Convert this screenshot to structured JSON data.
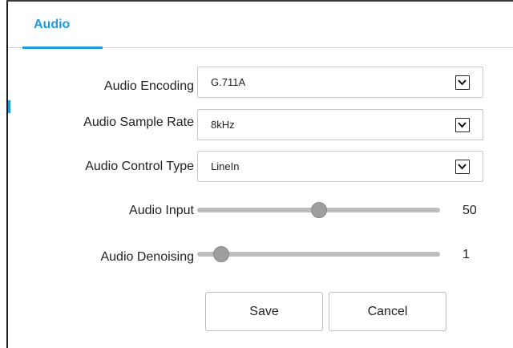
{
  "tab": {
    "label": "Audio"
  },
  "fields": {
    "audio_encoding": {
      "label": "Audio Encoding",
      "value": "G.711A"
    },
    "audio_sample_rate": {
      "label": "Audio Sample Rate",
      "value": "8kHz"
    },
    "audio_control_type": {
      "label": "Audio Control Type",
      "value": "LineIn"
    }
  },
  "sliders": {
    "audio_input": {
      "label": "Audio Input",
      "value": "50",
      "level": 0.5
    },
    "audio_denoising": {
      "label": "Audio Denoising",
      "value": "1",
      "level": 0.1
    }
  },
  "buttons": {
    "save": "Save",
    "cancel": "Cancel"
  },
  "colors": {
    "accent": "#1e9ae0",
    "slider_thumb": "#9e9e9e",
    "slider_track": "#bdbdbd"
  }
}
